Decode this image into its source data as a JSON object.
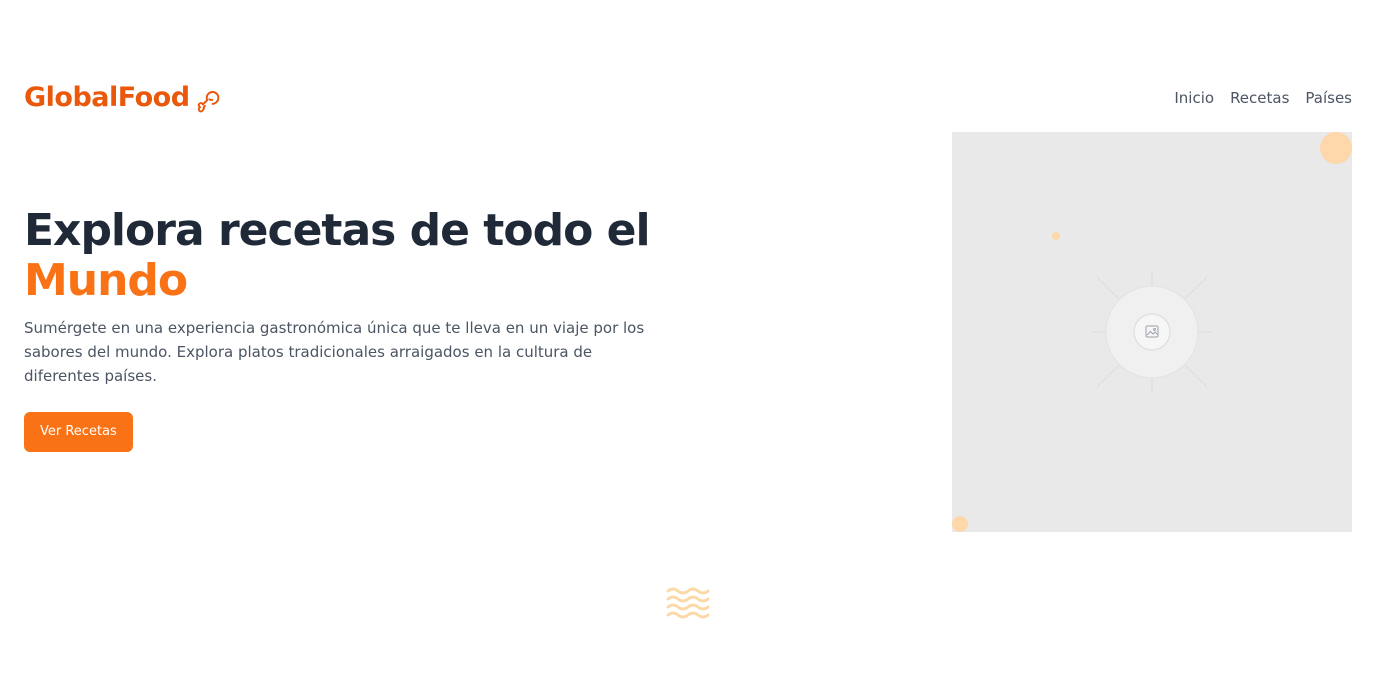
{
  "header": {
    "logo_text": "GlobalFood",
    "logo_icon": "drumstick-icon",
    "nav": [
      {
        "label": "Inicio"
      },
      {
        "label": "Recetas"
      },
      {
        "label": "Países"
      }
    ]
  },
  "hero": {
    "title_line1": "Explora recetas de todo el",
    "title_accent": "Mundo",
    "description": "Sumérgete en una experiencia gastronómica única que te lleva en un viaje por los sabores del mundo. Explora platos tradicionales arraigados en la cultura de diferentes países.",
    "cta_label": "Ver Recetas"
  },
  "media": {
    "icon": "image-placeholder-icon"
  },
  "decor": {
    "waves_icon": "waves-icon"
  },
  "colors": {
    "brand": "#ea580c",
    "accent": "#f97316",
    "heading": "#1f2937",
    "body_text": "#4b5563",
    "placeholder_bg": "#e9e9e9",
    "decor_peach": "#fed7aa"
  }
}
